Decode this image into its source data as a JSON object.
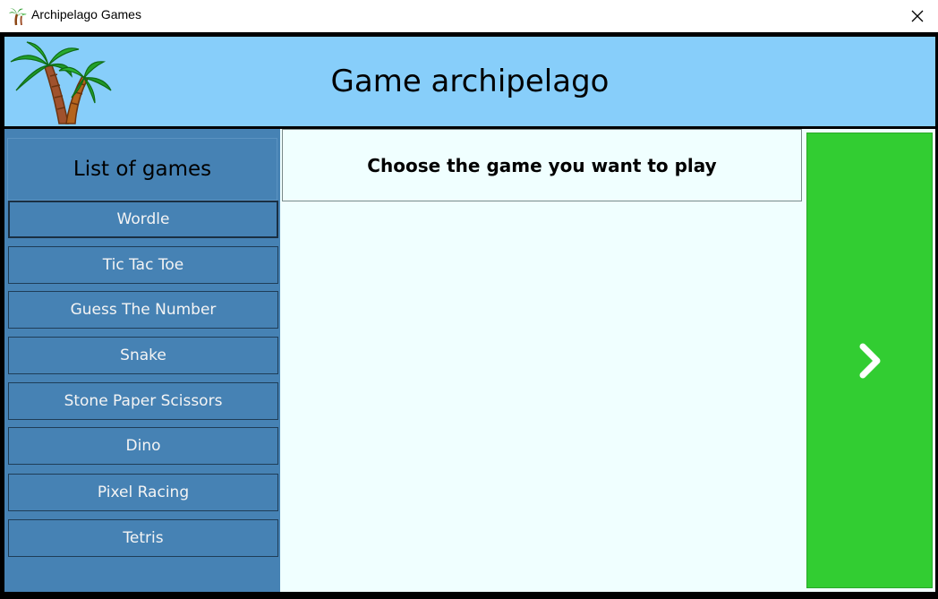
{
  "window": {
    "title": "Archipelago Games",
    "icon": "palm-tree-icon",
    "close_icon": "close-icon"
  },
  "header": {
    "title": "Game archipelago",
    "logo": "palm-trees-logo"
  },
  "sidebar": {
    "heading": "List of games",
    "games": [
      {
        "label": "Wordle"
      },
      {
        "label": "Tic Tac Toe"
      },
      {
        "label": "Guess The Number"
      },
      {
        "label": "Snake"
      },
      {
        "label": "Stone Paper Scissors"
      },
      {
        "label": "Dino"
      },
      {
        "label": "Pixel Racing"
      },
      {
        "label": "Tetris"
      }
    ]
  },
  "main": {
    "prompt": "Choose the game you want to play"
  },
  "next_button": {
    "icon": "chevron-right-icon"
  },
  "colors": {
    "header_bg": "#87cefa",
    "sidebar_bg": "#4682b4",
    "content_bg": "#f0ffff",
    "next_bg": "#32cd32"
  }
}
